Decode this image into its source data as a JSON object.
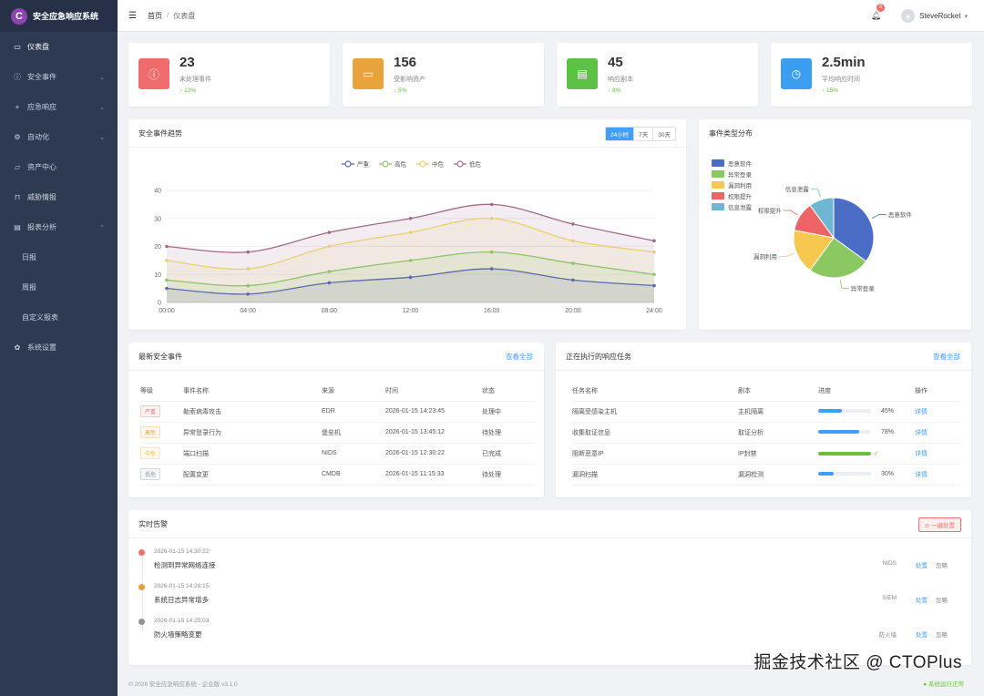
{
  "app": {
    "logo_letter": "C",
    "title": "安全应急响应系统"
  },
  "sidebar": {
    "items": [
      {
        "label": "仪表盘",
        "icon": "monitor-icon",
        "glyph": "▭",
        "chev": ""
      },
      {
        "label": "安全事件",
        "icon": "info-icon",
        "glyph": "ⓘ",
        "chev": "⌄"
      },
      {
        "label": "应急响应",
        "icon": "plus-icon",
        "glyph": "+",
        "chev": "⌄"
      },
      {
        "label": "自动化",
        "icon": "gear-icon",
        "glyph": "⚙",
        "chev": "⌄"
      },
      {
        "label": "资产中心",
        "icon": "folder-icon",
        "glyph": "▱",
        "chev": ""
      },
      {
        "label": "威胁情报",
        "icon": "bag-icon",
        "glyph": "⊓",
        "chev": ""
      },
      {
        "label": "报表分析",
        "icon": "document-icon",
        "glyph": "▤",
        "chev": "⌃"
      },
      {
        "label": "日报",
        "sub": true
      },
      {
        "label": "周报",
        "sub": true
      },
      {
        "label": "自定义报表",
        "sub": true
      },
      {
        "label": "系统设置",
        "icon": "settings-icon",
        "glyph": "✿",
        "chev": ""
      }
    ]
  },
  "header": {
    "breadcrumb_home": "首页",
    "breadcrumb_sep": "/",
    "breadcrumb_current": "仪表盘",
    "notification_count": "3",
    "username": "SteveRocket"
  },
  "stats": [
    {
      "value": "23",
      "label": "未处理事件",
      "trend": "↑ 12%",
      "color": "#ee6c6c",
      "icon": "alert-icon",
      "glyph": "ⓘ"
    },
    {
      "value": "156",
      "label": "受影响资产",
      "trend": "↓ 5%",
      "color": "#e8a33d",
      "icon": "monitor-icon",
      "glyph": "▭"
    },
    {
      "value": "45",
      "label": "响应剧本",
      "trend": "↑ 8%",
      "color": "#5dc146",
      "icon": "document-icon",
      "glyph": "▤"
    },
    {
      "value": "2.5min",
      "label": "平均响应时间",
      "trend": "↑ 15%",
      "color": "#3c9ef0",
      "icon": "clock-icon",
      "glyph": "◷"
    }
  ],
  "trend_card": {
    "title": "安全事件趋势",
    "ranges": [
      "24小时",
      "7天",
      "30天"
    ]
  },
  "chart_data": [
    {
      "type": "area",
      "x": [
        "00:00",
        "04:00",
        "08:00",
        "12:00",
        "16:00",
        "20:00",
        "24:00"
      ],
      "ylim": [
        0,
        40
      ],
      "yticks": [
        0,
        10,
        20,
        30,
        40
      ],
      "legend_position": "top-center",
      "grid": true,
      "series": [
        {
          "name": "严重",
          "color": "#5b6aa8",
          "values": [
            5,
            3,
            7,
            9,
            12,
            8,
            6
          ]
        },
        {
          "name": "高危",
          "color": "#8fc26a",
          "values": [
            8,
            6,
            11,
            15,
            18,
            14,
            10
          ]
        },
        {
          "name": "中危",
          "color": "#e9cf70",
          "values": [
            15,
            12,
            20,
            25,
            30,
            22,
            18
          ]
        },
        {
          "name": "低危",
          "color": "#a06a88",
          "values": [
            20,
            18,
            25,
            30,
            35,
            28,
            22
          ]
        }
      ]
    },
    {
      "type": "pie",
      "title": "事件类型分布",
      "legend_position": "left",
      "categories": [
        "恶意软件",
        "异常登录",
        "漏洞利用",
        "权限提升",
        "信息泄露"
      ],
      "values": [
        35,
        25,
        18,
        12,
        10
      ],
      "colors": [
        "#4a6cc4",
        "#8cc862",
        "#f6c84f",
        "#ee6466",
        "#6fb6d3"
      ],
      "outside_labels": [
        "恶意软件",
        "异常登录",
        "漏洞利用",
        "权限提升",
        "信息泄露"
      ]
    }
  ],
  "recent_events": {
    "title": "最新安全事件",
    "link": "查看全部",
    "columns": [
      "等级",
      "事件名称",
      "来源",
      "时间",
      "状态"
    ],
    "rows": [
      {
        "level": "严重",
        "level_color": "#f56c6c",
        "name": "勒索病毒攻击",
        "source": "EDR",
        "time": "2026-01-15 14:23:45",
        "status": "处理中"
      },
      {
        "level": "高危",
        "level_color": "#e6a23c",
        "name": "异常登录行为",
        "source": "堡垒机",
        "time": "2026-01-15 13:45:12",
        "status": "待处理"
      },
      {
        "level": "中危",
        "level_color": "#e6c23c",
        "name": "端口扫描",
        "source": "NIDS",
        "time": "2026-01-15 12:30:22",
        "status": "已完成"
      },
      {
        "level": "低危",
        "level_color": "#909399",
        "name": "配置变更",
        "source": "CMDB",
        "time": "2026-01-15 11:15:33",
        "status": "待处理"
      }
    ]
  },
  "running_tasks": {
    "title": "正在执行的响应任务",
    "link": "查看全部",
    "columns": [
      "任务名称",
      "剧本",
      "进度",
      "操作"
    ],
    "rows": [
      {
        "name": "隔离受感染主机",
        "playbook": "主机隔离",
        "progress": 45,
        "progress_label": "45%",
        "color": "#409eff",
        "action": "详情"
      },
      {
        "name": "收集取证信息",
        "playbook": "取证分析",
        "progress": 78,
        "progress_label": "78%",
        "color": "#409eff",
        "action": "详情"
      },
      {
        "name": "阻断恶意IP",
        "playbook": "IP封禁",
        "progress": 100,
        "progress_label": "✓",
        "color": "#67c23a",
        "action": "详情"
      },
      {
        "name": "漏洞扫描",
        "playbook": "漏洞检测",
        "progress": 30,
        "progress_label": "30%",
        "color": "#409eff",
        "action": "详情"
      }
    ]
  },
  "alerts": {
    "title": "实时告警",
    "button": "⊙ 一键处置",
    "items": [
      {
        "time": "2026-01-15 14:30:22",
        "message": "检测到异常网络连接",
        "source": "NIDS",
        "handle": "处置",
        "ignore": "忽略",
        "color": "#f56c6c"
      },
      {
        "time": "2026-01-15 14:28:15",
        "message": "系统日志异常增多",
        "source": "SIEM",
        "handle": "处置",
        "ignore": "忽略",
        "color": "#e6a23c"
      },
      {
        "time": "2026-01-15 14:25:03",
        "message": "防火墙策略变更",
        "source": "防火墙",
        "handle": "处置",
        "ignore": "忽略",
        "color": "#909399"
      }
    ]
  },
  "footer": {
    "left": "© 2026 安全应急响应系统 - 企业版 v3.1.0",
    "right": "● 系统运行正常"
  },
  "watermark": "掘金技术社区 @ CTOPlus"
}
